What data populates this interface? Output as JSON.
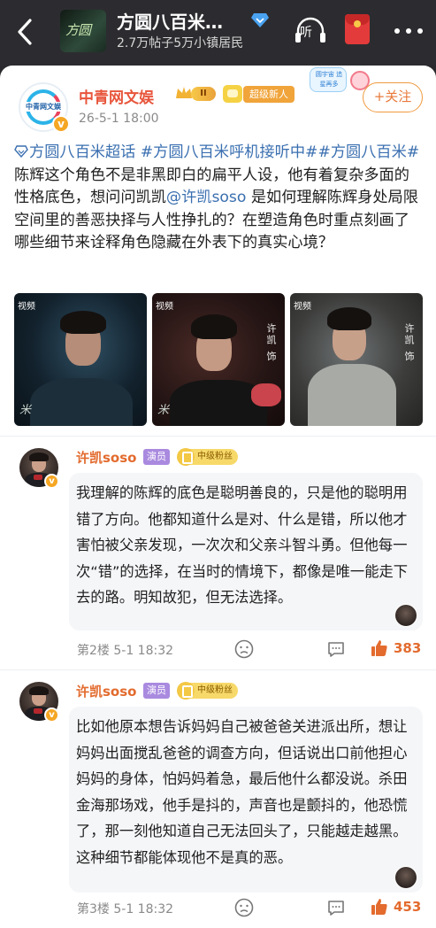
{
  "header": {
    "back_icon": "back-chevron-icon",
    "group_avatar_text": "方圆",
    "title": "方圆八百米…",
    "title_icon": "diamond-icon",
    "subtitle": "2.7万帖子5万小镇居民",
    "listen_icon": "listen-icon",
    "listen_label": "听",
    "redpack_icon": "red-envelope-icon",
    "more_icon": "more-dots-icon"
  },
  "post": {
    "author": "中青网文娱",
    "avatar_text": "中青网文娱",
    "verified": "v",
    "level_badge": "II",
    "newcomer_badge": "超级新人",
    "time": "26-5-1 18:00",
    "sticker_text": "圆宇宙 追星再多",
    "follow_label": "+关注",
    "text_parts": [
      {
        "type": "topic",
        "text": "方圆八百米超话 "
      },
      {
        "type": "topic",
        "text": "#方圆八百米呼机接听中##方圆八百米#"
      },
      {
        "type": "plain",
        "text": " 陈辉这个角色不是非黑即白的扁平人设，他有着复杂多面的性格底色，想问问凯凯"
      },
      {
        "type": "mention",
        "text": "@许凯soso"
      },
      {
        "type": "plain",
        "text": " 是如何理解陈辉身处局限空间里的善恶抉择与人性挣扎的？在塑造角色时重点刻画了哪些细节来诠释角色隐藏在外表下的真实心境？"
      }
    ],
    "videos": [
      {
        "tag": "视频",
        "name": "",
        "logo": "米"
      },
      {
        "tag": "视频",
        "name": "许凯 饰",
        "logo": "米"
      },
      {
        "tag": "视频",
        "name": "许凯 饰",
        "logo": ""
      }
    ]
  },
  "comments": [
    {
      "name": "许凯soso",
      "verified": "v",
      "role_badge": "演员",
      "fan_badge": "中级粉丝",
      "text": "我理解的陈辉的底色是聪明善良的，只是他的聪明用错了方向。他都知道什么是对、什么是错，所以他才害怕被父亲发现，一次次和父亲斗智斗勇。但他每一次“错”的选择，在当时的情境下，都像是唯一能走下去的路。明知故犯，但无法选择。",
      "floor_time": "第2楼 5-1 18:32",
      "likes": "383"
    },
    {
      "name": "许凯soso",
      "verified": "v",
      "role_badge": "演员",
      "fan_badge": "中级粉丝",
      "text": "比如他原本想告诉妈妈自己被爸爸关进派出所，想让妈妈出面搅乱爸爸的调查方向，但话说出口前他担心妈妈的身体，怕妈妈着急，最后他什么都没说。杀田金海那场戏，他手是抖的，声音也是颤抖的，他恐慌了，那一刻他知道自己无法回头了，只能越走越黑。这种细节都能体现他不是真的恶。",
      "floor_time": "第3楼 5-1 18:32",
      "likes": "453"
    }
  ],
  "colors": {
    "header_bg": "#2c2c30",
    "accent_orange": "#e36b2e",
    "topic_blue": "#3a6fb0",
    "bubble_bg": "#f5f6f8"
  }
}
